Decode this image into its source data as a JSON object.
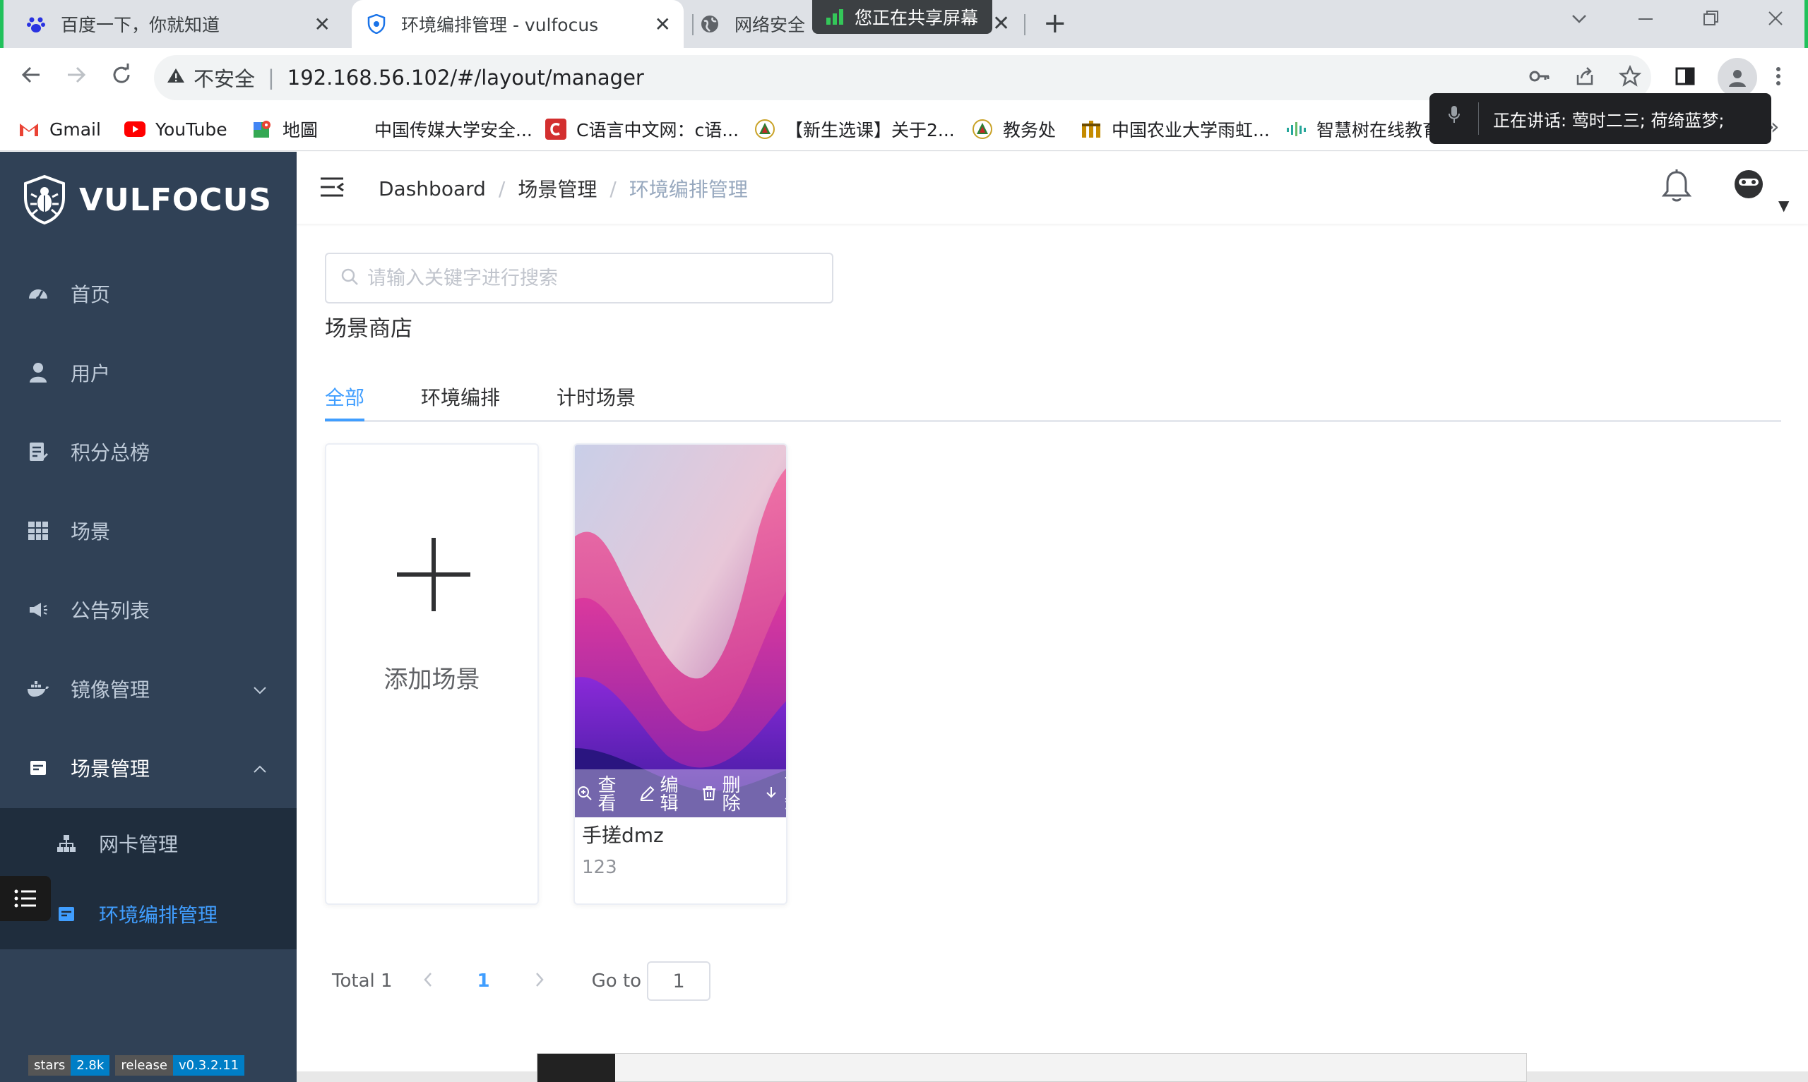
{
  "browser": {
    "tabs": [
      {
        "title": "百度一下，你就知道"
      },
      {
        "title": "环境编排管理 - vulfocus"
      },
      {
        "title": "网络安全"
      }
    ],
    "share_badge": "您正在共享屏幕",
    "address": {
      "insecure_label": "不安全",
      "url": "192.168.56.102/#/layout/manager"
    },
    "bookmarks": [
      {
        "label": "Gmail",
        "icon": "gmail-icon"
      },
      {
        "label": "YouTube",
        "icon": "youtube-icon"
      },
      {
        "label": "地圖",
        "icon": "maps-icon"
      },
      {
        "label": "中国传媒大学安全...",
        "icon": "blank"
      },
      {
        "label": "C语言中文网：c语...",
        "icon": "c-icon"
      },
      {
        "label": "【新生选课】关于2...",
        "icon": "school-icon"
      },
      {
        "label": "教务处",
        "icon": "school-icon"
      },
      {
        "label": "中国农业大学雨虹...",
        "icon": "cau-icon"
      },
      {
        "label": "智慧树在线教育",
        "icon": "zhihuishu-icon"
      }
    ],
    "speaking_toast": "正在讲话:  莺时二三; 荷绮蓝梦;"
  },
  "sidebar": {
    "brand": "VULFOCUS",
    "items": [
      {
        "label": "首页",
        "icon": "dashboard-icon"
      },
      {
        "label": "用户",
        "icon": "user-icon"
      },
      {
        "label": "积分总榜",
        "icon": "leaderboard-icon"
      },
      {
        "label": "场景",
        "icon": "grid-icon"
      },
      {
        "label": "公告列表",
        "icon": "announcement-icon"
      },
      {
        "label": "镜像管理",
        "icon": "docker-icon"
      },
      {
        "label": "场景管理",
        "icon": "scene-mgmt-icon"
      }
    ],
    "subitems": [
      {
        "label": "网卡管理",
        "icon": "network-icon"
      },
      {
        "label": "环境编排管理",
        "icon": "layout-icon"
      }
    ],
    "badges": [
      {
        "k": "stars",
        "v": "2.8k"
      },
      {
        "k": "release",
        "v": "v0.3.2.11"
      }
    ]
  },
  "breadcrumb": [
    "Dashboard",
    "场景管理",
    "环境编排管理"
  ],
  "search": {
    "placeholder": "请输入关键字进行搜索"
  },
  "store_title": "场景商店",
  "tabs": [
    "全部",
    "环境编排",
    "计时场景"
  ],
  "add_card": {
    "label": "添加场景"
  },
  "scene_card": {
    "name": "手搓dmz",
    "desc": "123",
    "actions": [
      "查看",
      "编辑",
      "删除",
      "下载"
    ]
  },
  "pagination": {
    "total": "Total 1",
    "current": "1",
    "goto_label": "Go to",
    "goto_value": "1"
  },
  "colors": {
    "accent": "#409eff",
    "sidebar": "#304156",
    "submenu": "#1f2d3d"
  }
}
